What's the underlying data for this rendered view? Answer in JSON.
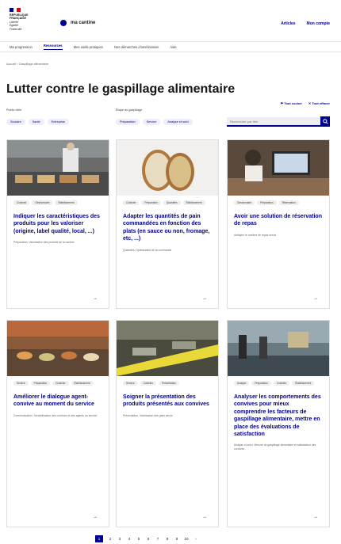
{
  "header": {
    "gov_lines": [
      "RÉPUBLIQUE",
      "FRANÇAISE",
      "Liberté",
      "Égalité",
      "Fraternité"
    ],
    "brand": "ma cantine",
    "links": [
      "Articles",
      "Mon compte"
    ]
  },
  "nav": [
    "Ma progression",
    "Ressources",
    "Mes outils pratiques",
    "Nos démarches d'amélioration",
    "Aide"
  ],
  "breadcrumb": "Accueil › Gaspillage alimentaire",
  "title": "Lutter contre le gaspillage alimentaire",
  "filters": {
    "group1_label": "Public cible",
    "group1_chips": [
      "Scolaire",
      "Santé",
      "Entreprise"
    ],
    "group2_label": "Étape du gaspillage",
    "group2_chips": [
      "Préparation",
      "Service",
      "Analyse et suivi"
    ],
    "actions": [
      "Tout cocher",
      "Tout effacer"
    ],
    "search_placeholder": "Rechercher par titre"
  },
  "cards": [
    {
      "tags": [
        "Cuisinier",
        "Gestionnaire",
        "Établissement"
      ],
      "title": "Indiquer les caractéristiques des produits pour les valoriser (origine, label qualité, local, ...)",
      "desc": "Préparation, Valorisation des produits de la cantine"
    },
    {
      "tags": [
        "Cuisinier",
        "Préparation",
        "Quantités",
        "Établissement"
      ],
      "title": "Adapter les quantités de pain commandées en fonction des plats (en sauce ou non, fromage, etc, ...)",
      "desc": "Quantités, Optimisation de la commande"
    },
    {
      "tags": [
        "Gestionnaire",
        "Préparation",
        "Réservation"
      ],
      "title": "Avoir une solution de réservation de repas",
      "desc": "Anticiper le nombre de repas servis"
    },
    {
      "tags": [
        "Service",
        "Préparation",
        "Cuisinier",
        "Établissement"
      ],
      "title": "Améliorer le dialogue agent-convive au moment du service",
      "desc": "Communication, Sensibilisation des convives et des agents au service"
    },
    {
      "tags": [
        "Service",
        "Cuisinier",
        "Présentation"
      ],
      "title": "Soigner la présentation des produits présentés aux convives",
      "desc": "Présentation, Valorisation des plats servis"
    },
    {
      "tags": [
        "Analyse",
        "Préparation",
        "Cuisinier",
        "Établissement"
      ],
      "title": "Analyser les comportements des convives pour mieux comprendre les facteurs de gaspillage alimentaire, mettre en place des évaluations de satisfaction",
      "desc": "Analyse et suivi, Mesure du gaspillage alimentaire et satisfaction des convives"
    }
  ],
  "pagination": [
    "1",
    "2",
    "3",
    "4",
    "5",
    "6",
    "7",
    "8",
    "9",
    "10",
    "›"
  ],
  "colors": {
    "primary": "#000091",
    "tag_bg": "#eeeef8"
  }
}
